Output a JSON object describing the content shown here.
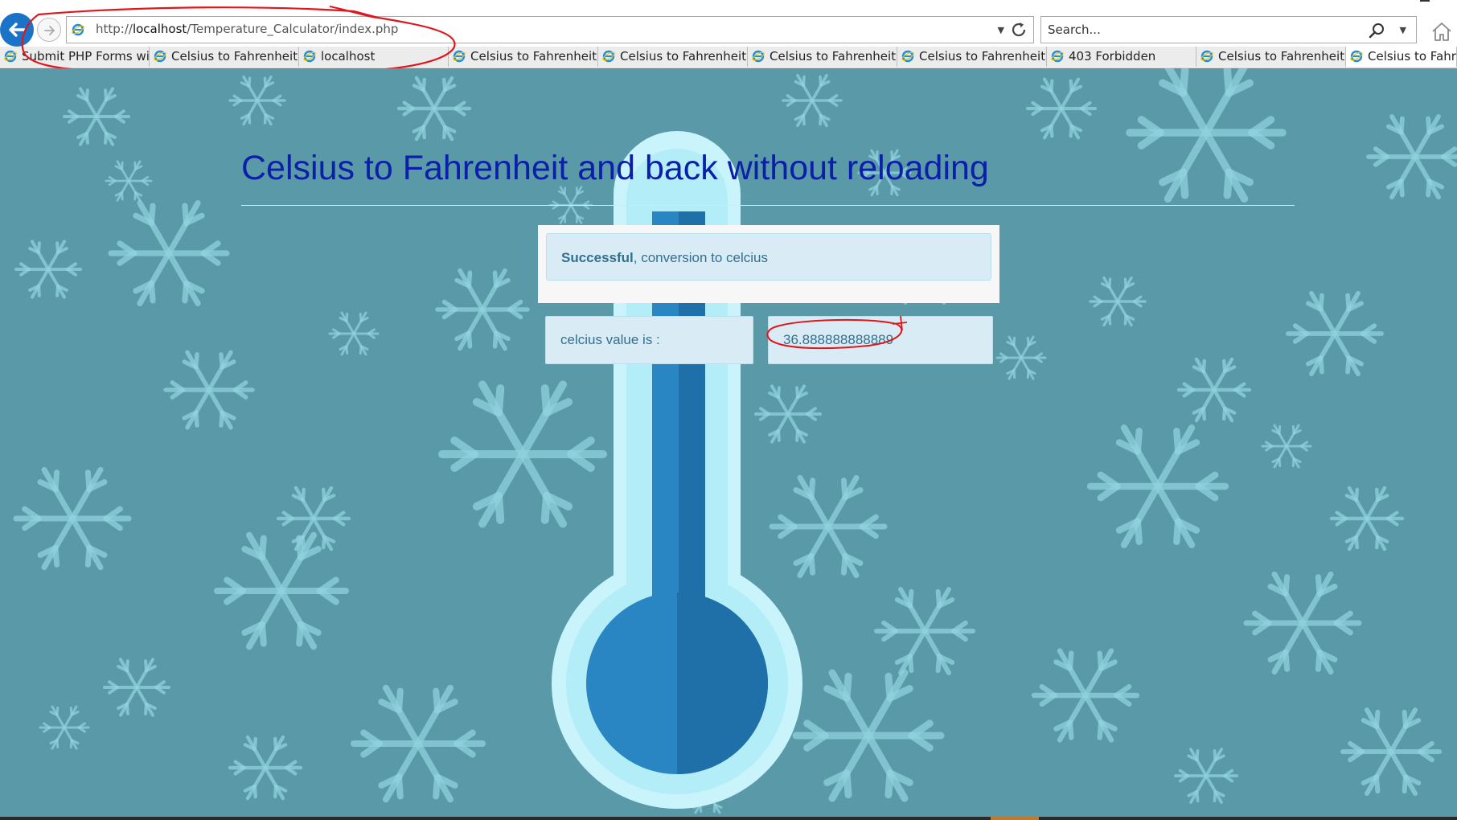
{
  "browser": {
    "address": {
      "url_prefix": "http://",
      "url_host": "localhost",
      "url_path": "/Temperature_Calculator/index.php"
    },
    "search_placeholder": "Search...",
    "tabs": [
      {
        "label": "Submit PHP Forms wi..."
      },
      {
        "label": "Celsius to Fahrenheit ..."
      },
      {
        "label": "localhost"
      },
      {
        "label": "Celsius to Fahrenheit ..."
      },
      {
        "label": "Celsius to Fahrenheit ..."
      },
      {
        "label": "Celsius to Fahrenheit ..."
      },
      {
        "label": "Celsius to Fahrenheit ..."
      },
      {
        "label": "403 Forbidden"
      },
      {
        "label": "Celsius to Fahrenheit ..."
      },
      {
        "label": "Celsius to Fahrenhei"
      }
    ],
    "active_tab_index": 9
  },
  "page": {
    "title": "Celsius to Fahrenheit and back without reloading",
    "alert": {
      "strong": "Successful",
      "message": ", conversion to celcius"
    },
    "result_label": "celcius value is :",
    "result_value": "36.888888888889"
  },
  "colors": {
    "background": "#5a9aa8",
    "title": "#0b1fa8",
    "alert_bg": "#d9ecf5",
    "alert_text": "#31708f",
    "annotation": "#e0161d"
  }
}
